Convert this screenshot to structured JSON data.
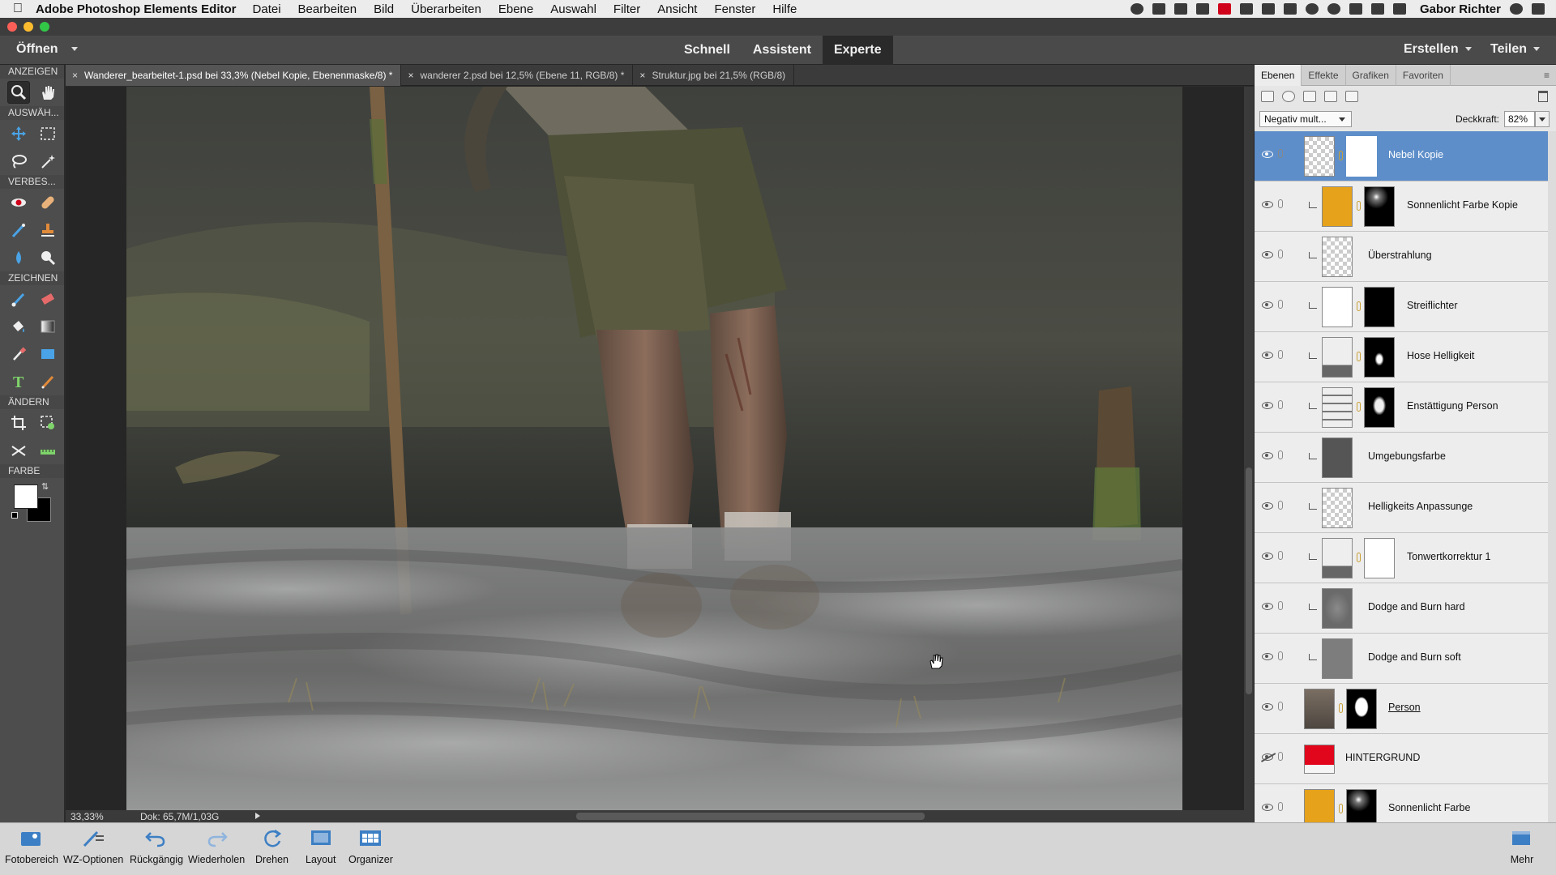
{
  "menubar": {
    "app_name": "Adobe Photoshop Elements Editor",
    "items": [
      "Datei",
      "Bearbeiten",
      "Bild",
      "Überarbeiten",
      "Ebene",
      "Auswahl",
      "Filter",
      "Ansicht",
      "Fenster",
      "Hilfe"
    ],
    "user": "Gabor Richter"
  },
  "modebar": {
    "open_label": "Öffnen",
    "modes": [
      "Schnell",
      "Assistent",
      "Experte"
    ],
    "active_mode": "Experte",
    "create_label": "Erstellen",
    "share_label": "Teilen"
  },
  "toolbox": {
    "sections": [
      "ANZEIGEN",
      "AUSWÄH...",
      "VERBES...",
      "ZEICHNEN",
      "ÄNDERN",
      "FARBE"
    ]
  },
  "doc_tabs": [
    "Wanderer_bearbeitet-1.psd bei 33,3% (Nebel Kopie, Ebenenmaske/8) *",
    "wanderer 2.psd bei 12,5% (Ebene 11, RGB/8) *",
    "Struktur.jpg bei 21,5% (RGB/8)"
  ],
  "status": {
    "zoom": "33,33%",
    "doc_size": "Dok: 65,7M/1,03G"
  },
  "layers_panel": {
    "tabs": [
      "Ebenen",
      "Effekte",
      "Grafiken",
      "Favoriten"
    ],
    "blend_mode": "Negativ mult...",
    "opacity_label": "Deckkraft:",
    "opacity_value": "82%",
    "layers": [
      {
        "name": "Nebel Kopie",
        "selected": true
      },
      {
        "name": "Sonnenlicht Farbe Kopie"
      },
      {
        "name": "Überstrahlung"
      },
      {
        "name": "Streiflichter"
      },
      {
        "name": "Hose Helligkeit"
      },
      {
        "name": "Enstättigung Person"
      },
      {
        "name": "Umgebungsfarbe"
      },
      {
        "name": "Helligkeits Anpassunge"
      },
      {
        "name": "Tonwertkorrektur 1"
      },
      {
        "name": "Dodge and Burn hard"
      },
      {
        "name": "Dodge and Burn soft"
      },
      {
        "name": "Person"
      },
      {
        "name": "HINTERGRUND",
        "visible": false
      },
      {
        "name": "Sonnenlicht Farbe"
      }
    ]
  },
  "taskbar": {
    "items": [
      "Fotobereich",
      "WZ-Optionen",
      "Rückgängig",
      "Wiederholen",
      "Drehen",
      "Layout",
      "Organizer"
    ],
    "more": "Mehr"
  },
  "colors": {
    "accent_blue": "#5d8ec9",
    "chrome_dark": "#4a4a4a",
    "panel_light": "#e9e9e9"
  }
}
